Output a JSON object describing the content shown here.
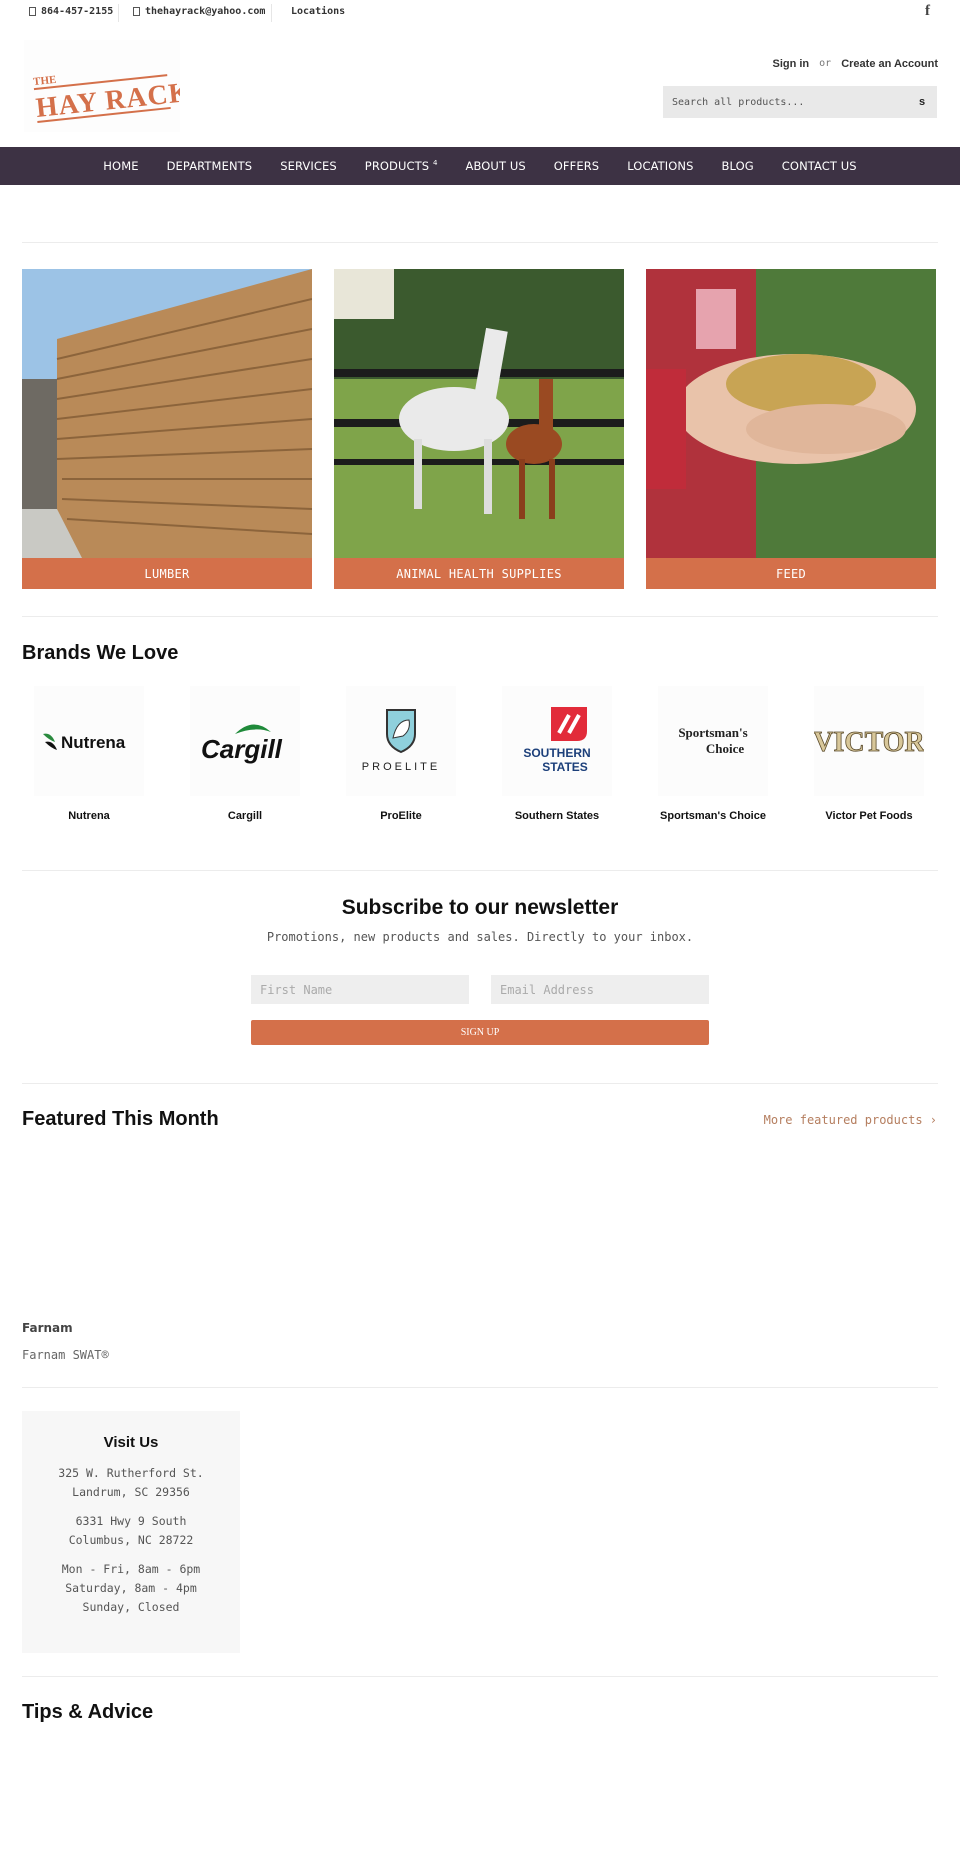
{
  "topbar": {
    "phone": "864-457-2155",
    "email": "thehayrack@yahoo.com",
    "locations": "Locations",
    "social_icon": "facebook-icon",
    "social_glyph": "f"
  },
  "header": {
    "logo_line1": "THE",
    "logo_line2": "HAY RACK",
    "sign_in": "Sign in",
    "or": "or",
    "create_account": "Create an Account",
    "search_placeholder": "Search all products...",
    "search_button": "s"
  },
  "nav": {
    "items": [
      {
        "label": "HOME"
      },
      {
        "label": "DEPARTMENTS"
      },
      {
        "label": "SERVICES"
      },
      {
        "label": "PRODUCTS",
        "dropdown_glyph": "4"
      },
      {
        "label": "ABOUT US"
      },
      {
        "label": "OFFERS"
      },
      {
        "label": "LOCATIONS"
      },
      {
        "label": "BLOG"
      },
      {
        "label": "CONTACT US"
      }
    ]
  },
  "categories": [
    {
      "label": "LUMBER",
      "image": "lumber-photo"
    },
    {
      "label": "ANIMAL HEALTH SUPPLIES",
      "image": "horses-photo"
    },
    {
      "label": "FEED",
      "image": "feed-photo"
    }
  ],
  "brands": {
    "title": "Brands We Love",
    "items": [
      {
        "name": "Nutrena",
        "logo_text": "Nutrena"
      },
      {
        "name": "Cargill",
        "logo_text": "Cargill"
      },
      {
        "name": "ProElite",
        "logo_text": "PROELITE"
      },
      {
        "name": "Southern States",
        "logo_text": "SOUTHERN STATES"
      },
      {
        "name": "Sportsman's Choice",
        "logo_text_1": "Sportsman's",
        "logo_text_2": "Choice"
      },
      {
        "name": "Victor Pet Foods",
        "logo_text": "VICTOR"
      }
    ]
  },
  "newsletter": {
    "title": "Subscribe to our newsletter",
    "subtitle": "Promotions, new products and sales. Directly to your inbox.",
    "first_name_placeholder": "First Name",
    "email_placeholder": "Email Address",
    "button": "SIGN UP"
  },
  "featured": {
    "title": "Featured This Month",
    "more_link": "More featured products ›",
    "products": [
      {
        "vendor": "Farnam",
        "title": "Farnam SWAT®"
      }
    ]
  },
  "visit": {
    "title": "Visit Us",
    "locations": [
      {
        "line1": "325 W. Rutherford St.",
        "line2": "Landrum, SC 29356"
      },
      {
        "line1": "6331 Hwy 9 South",
        "line2": "Columbus, NC 28722"
      }
    ],
    "hours": [
      "Mon - Fri, 8am - 6pm",
      "Saturday, 8am - 4pm",
      "Sunday, Closed"
    ]
  },
  "tips": {
    "title": "Tips & Advice"
  },
  "colors": {
    "accent": "#d4704a",
    "nav_bg": "#3d3244",
    "link": "#b57e5f"
  }
}
